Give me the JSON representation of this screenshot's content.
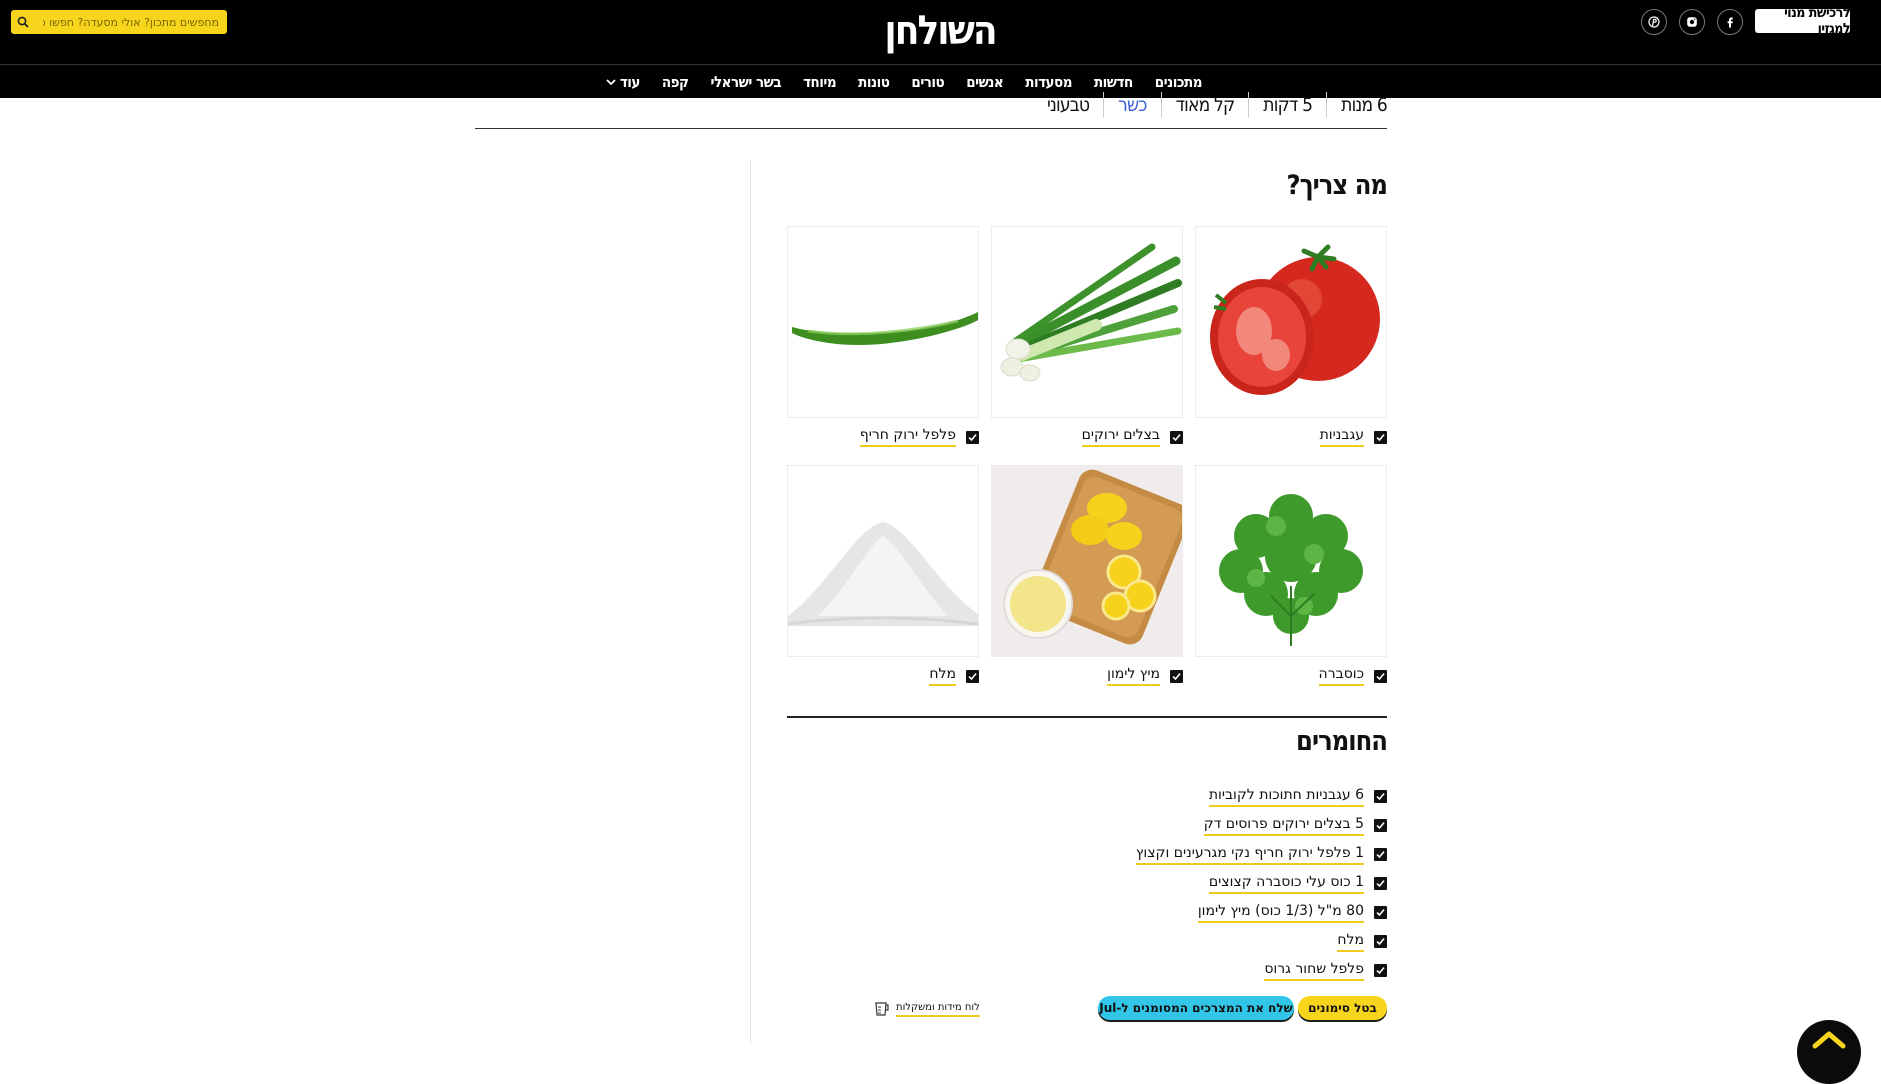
{
  "header": {
    "logo": "השולחן",
    "search_placeholder": "מחפשים מתכון? אולי מסעדה? חפשו כאן",
    "subscribe_label": "לרכישת מנוי למגזין",
    "social_icons": [
      "pinterest-icon",
      "instagram-icon",
      "facebook-icon"
    ]
  },
  "nav": {
    "items": [
      "מתכונים",
      "חדשות",
      "מסעדות",
      "אנשים",
      "טורים",
      "טונות",
      "מיוחד",
      "בשר ישראלי",
      "קפה"
    ],
    "more_label": "עוד"
  },
  "tags": [
    "6 מנות",
    "5 דקות",
    "קל מאוד",
    "כשר",
    "טבעוני"
  ],
  "active_tag": "כשר",
  "what_needed": {
    "title": "מה צריך?",
    "items": [
      {
        "label": "עגבניות",
        "icon": "tomato-image"
      },
      {
        "label": "בצלים ירוקים",
        "icon": "green-onion-image"
      },
      {
        "label": "פלפל ירוק חריף",
        "icon": "green-chili-image"
      },
      {
        "label": "כוסברה",
        "icon": "cilantro-image"
      },
      {
        "label": "מיץ לימון",
        "icon": "lemon-juice-image"
      },
      {
        "label": "מלח",
        "icon": "salt-image"
      }
    ]
  },
  "ingredients": {
    "title": "החומרים",
    "items": [
      "6 עגבניות חתוכות לקוביות",
      "5 בצלים ירוקים פרוסים דק",
      "1 פלפל ירוק חריף נקי מגרעינים וקצוץ",
      "1 כוס עלי כוסברה קצוצים",
      "80 מ\"ל (1/3 כוס) מיץ לימון",
      "מלח",
      "פלפל שחור גרוס"
    ]
  },
  "actions": {
    "cancel_label": "בטל סימונים",
    "send_label": "שלח את המצרכים המסומנים ל-Jul",
    "measure_label": "לוח מידות ומשקלות"
  },
  "colors": {
    "accent_yellow": "#f7d51d",
    "accent_cyan": "#31c6e7",
    "active_tag": "#3a5bd9",
    "header_bg": "#000000"
  }
}
